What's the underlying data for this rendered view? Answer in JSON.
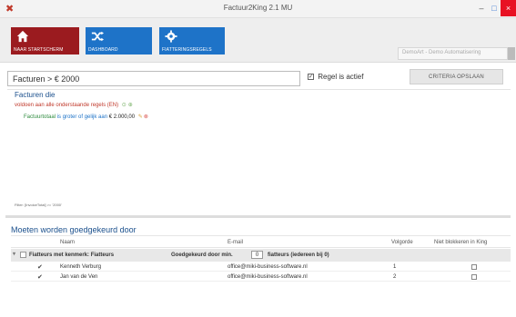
{
  "window": {
    "title": "Factuur2King 2.1 MU",
    "minimize_glyph": "–",
    "maximize_glyph": "□",
    "close_glyph": "×",
    "app_icon": "x-logo-icon",
    "accent_color": "#9b1b1f"
  },
  "ribbon": {
    "tiles": [
      {
        "label": "NAAR STARTSCHERM",
        "icon": "home-icon",
        "color": "#9b1b1f"
      },
      {
        "label": "DASHBOARD",
        "icon": "shuffle-icon",
        "color": "#1e73c8"
      },
      {
        "label": "FIATTERINGSREGELS",
        "icon": "gear-icon",
        "color": "#1e73c8"
      }
    ],
    "company": "DemoArt - Demo Automatisering"
  },
  "filter": {
    "title": "Facturen > € 2000",
    "active_check_glyph": "✓",
    "active_label": "Regel is actief",
    "save_button": "CRITERIA OPSLAAN"
  },
  "rules": {
    "panel_title": "Facturen die",
    "root": "voldoen aan alle onderstaande regels (EN)",
    "item_field": "Factuurtotaal",
    "item_operator": "is groter of gelijk aan",
    "item_value": "€ 2.000,00",
    "expression": "Filter: [InvoiceTotal] >= '2000'"
  },
  "approval": {
    "title": "Moeten worden goedgekeurd door",
    "columns": [
      "Naam",
      "E-mail",
      "Volgorde",
      "Niet blokkeren in King"
    ],
    "group": {
      "label": "Fiatteurs met kenmerk: Fiatteurs",
      "min_label": "Goedgekeurd door min.",
      "min_value": "0",
      "suffix": "fiatteurs (iedereen bij 0)"
    },
    "rows": [
      {
        "name": "Kenneth Verburg",
        "email": "office@miki-business-software.nl",
        "order": "1"
      },
      {
        "name": "Jan van de Ven",
        "email": "office@miki-business-software.nl",
        "order": "2"
      }
    ]
  }
}
